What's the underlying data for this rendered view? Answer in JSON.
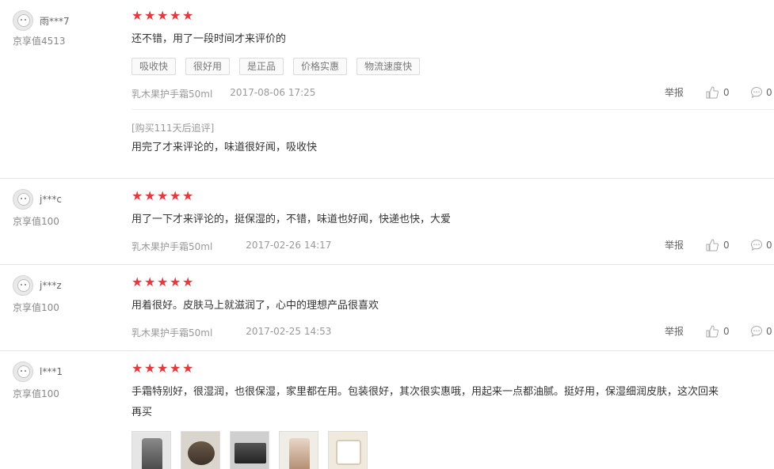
{
  "reviews": [
    {
      "username": "雨***7",
      "level": "京享值4513",
      "stars": 5,
      "content": "还不错，用了一段时间才来评价的",
      "tags": [
        "吸收快",
        "很好用",
        "是正品",
        "价格实惠",
        "物流速度快"
      ],
      "product": "乳木果护手霜50ml",
      "date": "2017-08-06 17:25",
      "report": "举报",
      "likes": "0",
      "replies": "0",
      "append_label": "[购买111天后追评]",
      "append_content": "用完了才来评论的，味道很好闻，吸收快"
    },
    {
      "username": "j***c",
      "level": "京享值100",
      "stars": 5,
      "content": "用了一下才来评论的，挺保湿的，不错，味道也好闻，快递也快，大爱",
      "product": "乳木果护手霜50ml",
      "date": "2017-02-26 14:17",
      "report": "举报",
      "likes": "0",
      "replies": "0"
    },
    {
      "username": "j***z",
      "level": "京享值100",
      "stars": 5,
      "content": "用着很好。皮肤马上就滋润了，心中的理想产品很喜欢",
      "product": "乳木果护手霜50ml",
      "date": "2017-02-25 14:53",
      "report": "举报",
      "likes": "0",
      "replies": "0"
    },
    {
      "username": "l***1",
      "level": "京享值100",
      "stars": 5,
      "content_line1": "手霜特别好，很湿润，也很保湿，家里都在用。包装很好，其次很实惠哦，用起来一点都油腻。挺好用，保湿细润皮肤，这次回来",
      "content_line2": "再买",
      "photos": 5
    }
  ],
  "colors": {
    "star": "#e4393c",
    "border": "#e4e4e4"
  },
  "icons": {
    "like": "thumb-up-icon",
    "reply": "comment-icon"
  }
}
